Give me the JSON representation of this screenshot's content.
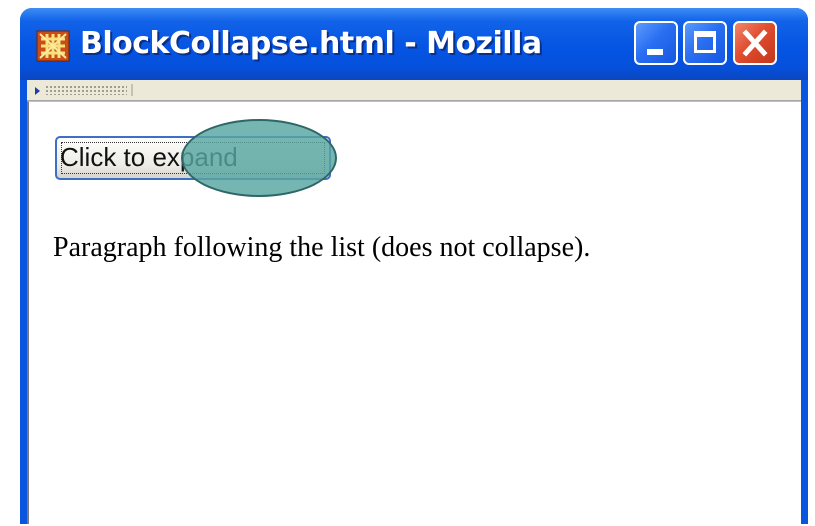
{
  "window": {
    "title": "BlockCollapse.html - Mozilla",
    "accent_color": "#0a55e0",
    "close_color": "#e14d2f"
  },
  "titlebar_controls": {
    "minimize_icon": "minimize-icon",
    "maximize_icon": "maximize-icon",
    "close_icon": "close-icon"
  },
  "content": {
    "button_label": "Click to expand",
    "paragraph": "Paragraph following the list (does not collapse)."
  },
  "annotation": {
    "shape": "ellipse",
    "color": "#58a6a1"
  }
}
